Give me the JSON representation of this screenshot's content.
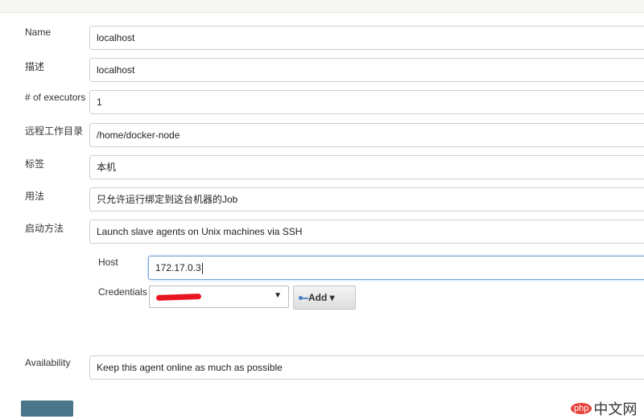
{
  "form": {
    "name": {
      "label": "Name",
      "value": "localhost"
    },
    "description": {
      "label": "描述",
      "value": "localhost"
    },
    "executors": {
      "label": "# of executors",
      "value": "1"
    },
    "remote_root": {
      "label": "远程工作目录",
      "value": "/home/docker-node"
    },
    "labels": {
      "label": "标签",
      "value": "本机"
    },
    "usage": {
      "label": "用法",
      "value": "只允许运行绑定到这台机器的Job"
    },
    "launch_method": {
      "label": "启动方法",
      "value": "Launch slave agents on Unix machines via SSH"
    },
    "host": {
      "label": "Host",
      "value": "172.17.0.3"
    },
    "credentials": {
      "label": "Credentials",
      "add_label": "Add",
      "add_arrow": "▾",
      "dropdown_arrow": "▼"
    },
    "availability": {
      "label": "Availability",
      "value": "Keep this agent online as much as possible"
    }
  },
  "watermark": {
    "badge": "php",
    "text": "中文网"
  },
  "colors": {
    "save_button": "#4b758b",
    "redaction": "#e8141f",
    "focus_border": "#76a6d6"
  }
}
